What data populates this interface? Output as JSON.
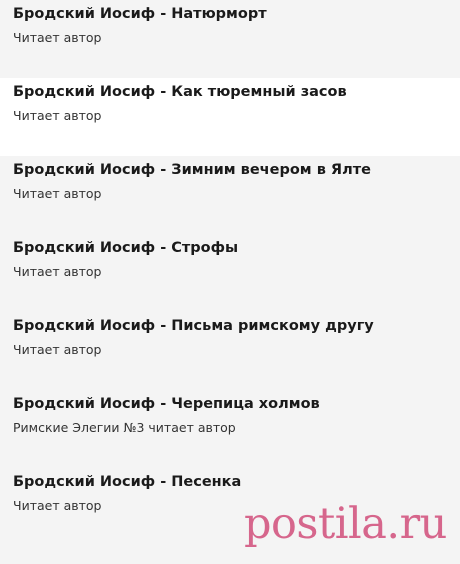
{
  "items": [
    {
      "title": "Бродский Иосиф - Натюрморт",
      "subtitle": "Читает автор"
    },
    {
      "title": "Бродский Иосиф - Как тюремный засов",
      "subtitle": "Читает автор"
    },
    {
      "title": "Бродский Иосиф - Зимним вечером в Ялте",
      "subtitle": "Читает автор"
    },
    {
      "title": "Бродский Иосиф - Строфы",
      "subtitle": "Читает автор"
    },
    {
      "title": "Бродский Иосиф - Письма римскому другу",
      "subtitle": "Читает автор"
    },
    {
      "title": "Бродский Иосиф - Черепица холмов",
      "subtitle": "Римские Элегии №3 читает автор"
    },
    {
      "title": "Бродский Иосиф - Песенка",
      "subtitle": "Читает автор"
    }
  ],
  "watermark": {
    "text": "postila.ru",
    "color": "#c8245c"
  },
  "colors": {
    "row_background": "#f4f4f4",
    "row_highlight": "#ffffff",
    "title_text": "#1a1a1a",
    "subtitle_text": "#333333"
  }
}
